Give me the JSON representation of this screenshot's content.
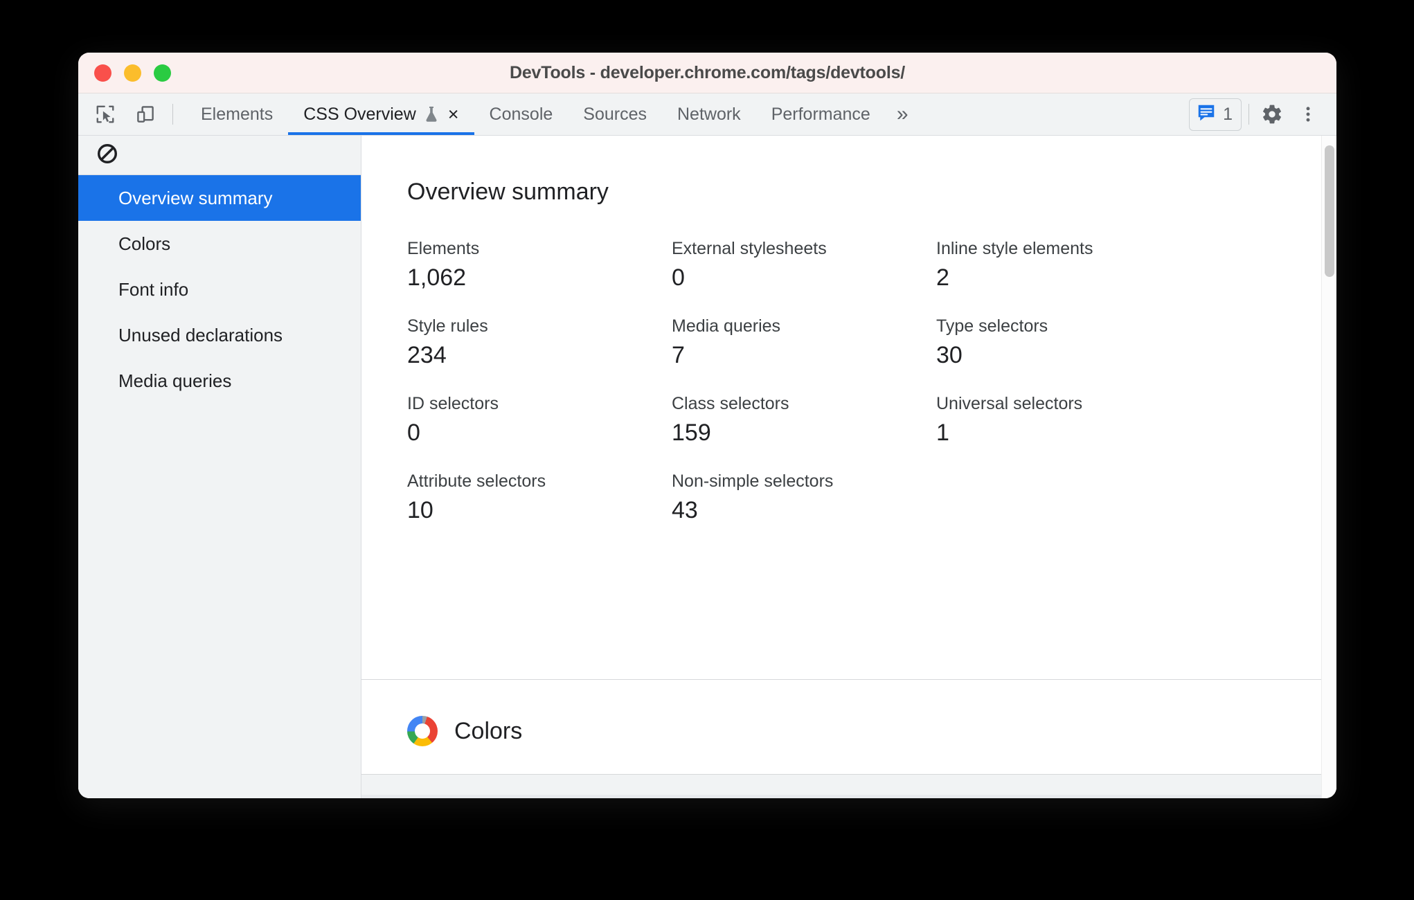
{
  "window": {
    "title": "DevTools - developer.chrome.com/tags/devtools/",
    "traffic_lights": [
      "close",
      "minimize",
      "zoom"
    ],
    "colors": {
      "titlebar_bg": "#FBF0EF",
      "tabbar_bg": "#F1F3F4",
      "accent_blue": "#1A73E8",
      "red": "#F9504B",
      "yellow": "#FBBD2C",
      "green": "#2ACB42"
    }
  },
  "toolbar": {
    "inspect_icon": "inspect-cursor-icon",
    "device_icon": "device-toolbar-icon",
    "overflow_label": "»",
    "message_count": "1",
    "message_icon": "message-bubble-icon",
    "settings_icon": "gear-icon",
    "more_icon": "three-dot-menu-icon"
  },
  "tabs": [
    {
      "label": "Elements",
      "active": false,
      "closable": false,
      "experimental": false
    },
    {
      "label": "CSS Overview",
      "active": true,
      "closable": true,
      "experimental": true,
      "close_label": "×"
    },
    {
      "label": "Console",
      "active": false,
      "closable": false,
      "experimental": false
    },
    {
      "label": "Sources",
      "active": false,
      "closable": false,
      "experimental": false
    },
    {
      "label": "Network",
      "active": false,
      "closable": false,
      "experimental": false
    },
    {
      "label": "Performance",
      "active": false,
      "closable": false,
      "experimental": false
    }
  ],
  "sidebar": {
    "clear_icon": "clear-overview-icon",
    "items": [
      {
        "label": "Overview summary",
        "selected": true
      },
      {
        "label": "Colors",
        "selected": false
      },
      {
        "label": "Font info",
        "selected": false
      },
      {
        "label": "Unused declarations",
        "selected": false
      },
      {
        "label": "Media queries",
        "selected": false
      }
    ]
  },
  "main": {
    "title": "Overview summary",
    "metrics": [
      {
        "label": "Elements",
        "value": "1,062"
      },
      {
        "label": "External stylesheets",
        "value": "0"
      },
      {
        "label": "Inline style elements",
        "value": "2"
      },
      {
        "label": "Style rules",
        "value": "234"
      },
      {
        "label": "Media queries",
        "value": "7"
      },
      {
        "label": "Type selectors",
        "value": "30"
      },
      {
        "label": "ID selectors",
        "value": "0"
      },
      {
        "label": "Class selectors",
        "value": "159"
      },
      {
        "label": "Universal selectors",
        "value": "1"
      },
      {
        "label": "Attribute selectors",
        "value": "10"
      },
      {
        "label": "Non-simple selectors",
        "value": "43"
      }
    ],
    "colors_section": {
      "title": "Colors",
      "icon": "color-wheel-icon"
    }
  }
}
